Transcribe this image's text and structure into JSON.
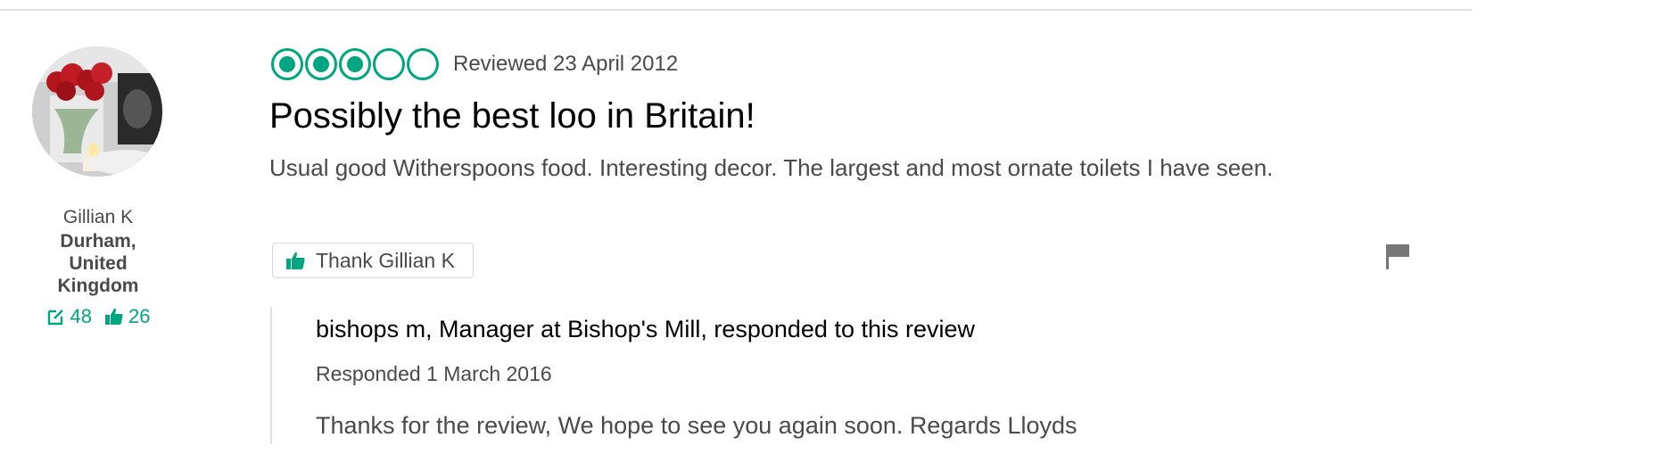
{
  "review": {
    "rating": 3,
    "max_rating": 5,
    "date_text": "Reviewed 23 April 2012",
    "title": "Possibly the best loo in Britain!",
    "body": "Usual good Witherspoons food. Interesting decor. The largest and most ornate toilets I have seen.",
    "thank_label": "Thank Gillian K",
    "accent_color": "#00a680"
  },
  "reviewer": {
    "name": "Gillian K",
    "location": "Durham, United Kingdom",
    "contributions": "48",
    "helpful_votes": "26"
  },
  "response": {
    "header": "bishops m, Manager at Bishop's Mill, responded to this review",
    "date_text": "Responded 1 March 2016",
    "body": "Thanks for the review, We hope to see you again soon. Regards Lloyds"
  },
  "icons": {
    "contributions": "edit-icon",
    "helpful": "thumbs-up-icon",
    "report": "flag-icon"
  }
}
